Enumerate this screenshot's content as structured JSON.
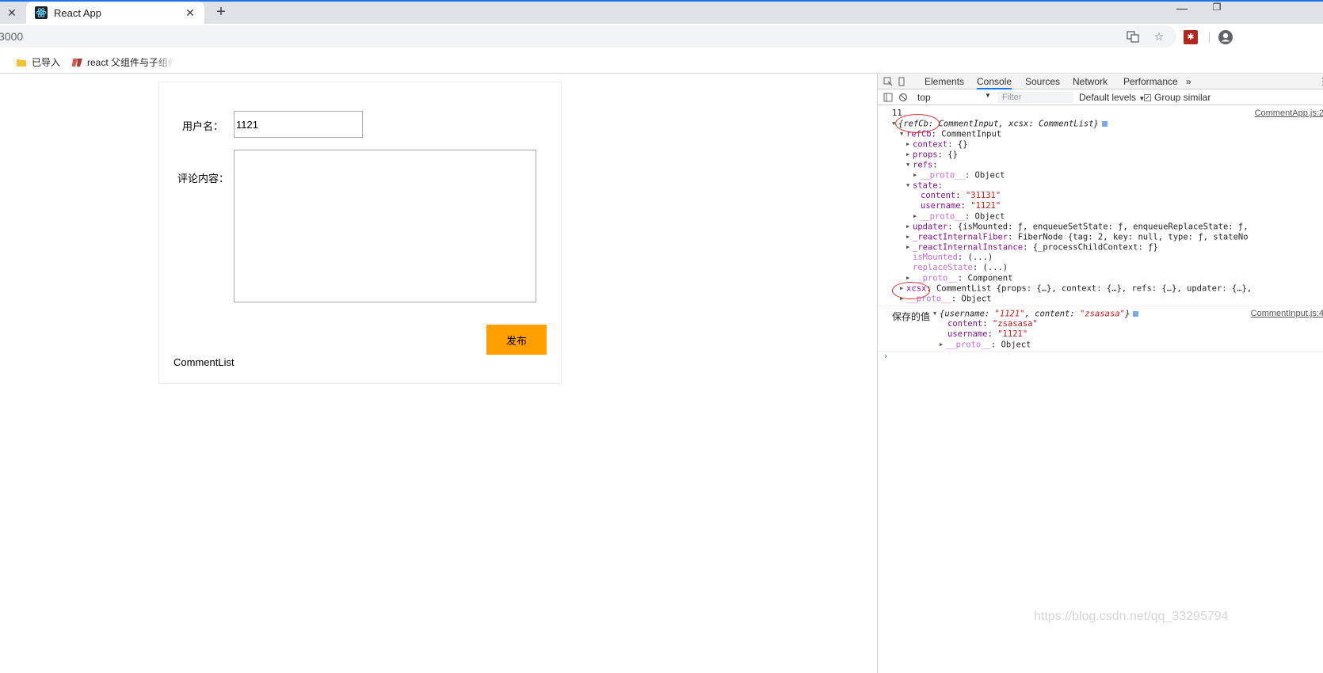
{
  "browser": {
    "tab_title": "React App",
    "url_fragment": "3000",
    "bookmarks": [
      {
        "label": "已导入",
        "icon": "folder-icon"
      },
      {
        "label": "react 父组件与子组件",
        "icon": "bookmark-site-icon"
      }
    ],
    "accent": "#1a73e8"
  },
  "app": {
    "username_label": "用户名：",
    "username_value": "1121",
    "content_label": "评论内容：",
    "content_value": "",
    "publish_label": "发布",
    "comment_list": "CommentList",
    "accent": "#ff9f00"
  },
  "devtools": {
    "tabs": [
      "Elements",
      "Console",
      "Sources",
      "Network",
      "Performance"
    ],
    "active_tab": "Console",
    "more": "»",
    "context": "top",
    "filter_placeholder": "Filter",
    "levels": "Default levels",
    "group_similar": "Group similar",
    "log1": {
      "source": "CommentApp.js:2",
      "count_line": "11",
      "summary_a": "{refCb: ",
      "summary_b": "CommentInput, xcsx: CommentList}",
      "refcb_key": "refCb",
      "refcb_val": ": CommentInput",
      "context_key": "context",
      "context_val": ": {}",
      "props_key": "props",
      "props_val": ": {}",
      "refs_key": "refs",
      "refs_val": ":",
      "proto1_key": "__proto__",
      "proto1_val": ": Object",
      "state_key": "state",
      "state_val": ":",
      "content_key": "content",
      "content_val": "\"31131\"",
      "username_key": "username",
      "username_val": "\"1121\"",
      "proto2_key": "__proto__",
      "proto2_val": ": Object",
      "updater_key": "updater",
      "updater_val": ": {isMounted: ƒ, enqueueSetState: ƒ, enqueueReplaceState: ƒ,",
      "fiber_key": "_reactInternalFiber",
      "fiber_val": ": FiberNode {tag: 2, key: null, type: ƒ, stateNo",
      "instance_key": "_reactInternalInstance",
      "instance_val": ": {_processChildContext: ƒ}",
      "ismounted_key": "isMounted",
      "ismounted_val": ": (...)",
      "replacestate_key": "replaceState",
      "replacestate_val": ": (...)",
      "proto3_key": "__proto__",
      "proto3_val": ": Component",
      "xcsx_key": "xcsx",
      "xcsx_val": ": CommentList {props: {…}, context: {…}, refs: {…}, updater: {…},",
      "proto4_key": "__proto__",
      "proto4_val": ": Object"
    },
    "log2": {
      "label": "保存的值",
      "source": "CommentInput.js:4",
      "summary_a": "{username: ",
      "summary_u": "\"1121\"",
      "summary_b": ", content: ",
      "summary_c": "\"zsasasa\"",
      "summary_d": "}",
      "content_key": "content",
      "content_val": "\"zsasasa\"",
      "username_key": "username",
      "username_val": "\"1121\"",
      "proto_key": "__proto__",
      "proto_val": ": Object"
    }
  },
  "watermark": "https://blog.csdn.net/qq_33295794"
}
